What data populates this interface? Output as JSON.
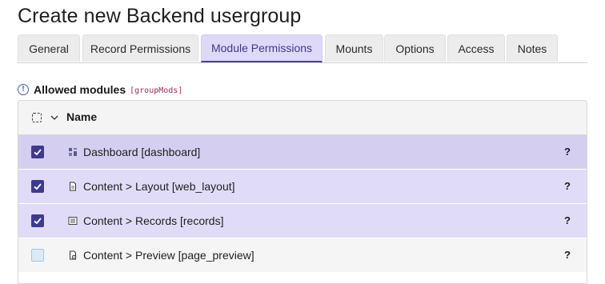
{
  "page": {
    "title": "Create new Backend usergroup"
  },
  "tabs": [
    {
      "label": "General",
      "active": false
    },
    {
      "label": "Record Permissions",
      "active": false
    },
    {
      "label": "Module Permissions",
      "active": true
    },
    {
      "label": "Mounts",
      "active": false
    },
    {
      "label": "Options",
      "active": false
    },
    {
      "label": "Access",
      "active": false
    },
    {
      "label": "Notes",
      "active": false
    }
  ],
  "section": {
    "label": "Allowed modules",
    "field_name": "[groupMods]",
    "info_icon": "!"
  },
  "table": {
    "columns": {
      "name": "Name"
    },
    "rows": [
      {
        "label": "Dashboard [dashboard]",
        "checked": true,
        "icon": "dashboard-icon",
        "help": "?"
      },
      {
        "label": "Content > Layout [web_layout]",
        "checked": true,
        "icon": "page-icon",
        "help": "?"
      },
      {
        "label": "Content > Records [records]",
        "checked": true,
        "icon": "list-icon",
        "help": "?"
      },
      {
        "label": "Content > Preview [page_preview]",
        "checked": false,
        "icon": "preview-icon",
        "help": "?"
      }
    ]
  },
  "colors": {
    "accent": "#3f3a8e",
    "active_tab_bg": "#ddd9f7",
    "checked_row_bg": "#e0dcf7",
    "hover_row_bg": "#d4cff0",
    "field_code": "#9a2f5a"
  }
}
